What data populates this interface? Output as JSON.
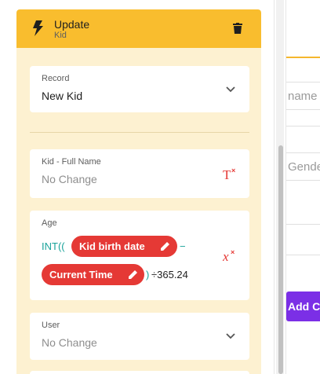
{
  "header": {
    "title": "Update",
    "subtitle": "Kid"
  },
  "record": {
    "label": "Record",
    "value": "New Kid"
  },
  "full_name": {
    "label": "Kid - Full Name",
    "value": "No Change"
  },
  "age": {
    "label": "Age",
    "prefix": "INT((",
    "pill1": "Kid birth date",
    "minus": "−",
    "pill2": "Current Time",
    "suffix_paren": ")",
    "suffix": "÷365.24"
  },
  "user": {
    "label": "User",
    "value": "No Change"
  },
  "right_panel": {
    "field1": "name",
    "field2": "Gende",
    "button": "Add Ch"
  },
  "colors": {
    "header": "#f9bd2e",
    "card": "#fdf1d1",
    "pill": "#e53935",
    "accent_purple": "#7b2fe6"
  }
}
